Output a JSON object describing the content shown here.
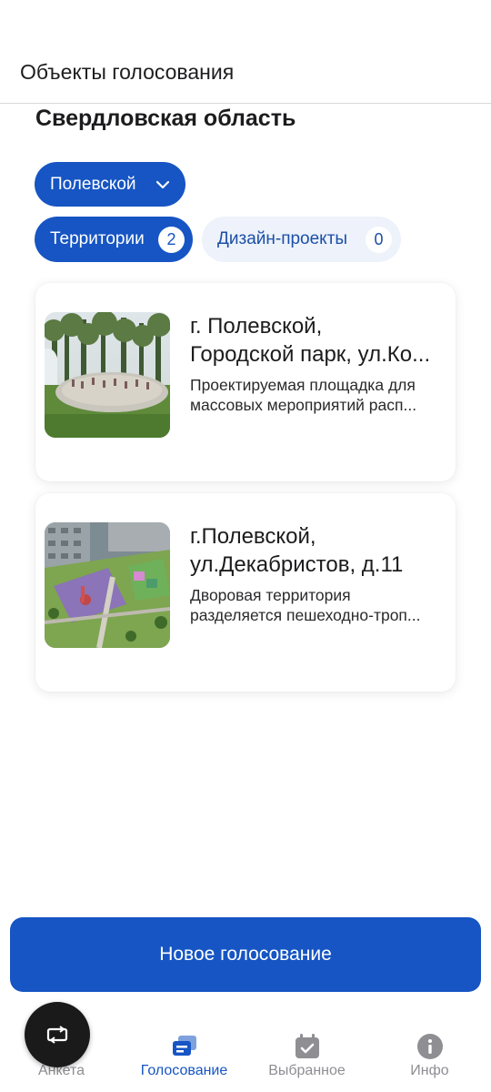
{
  "header": {
    "title": "Объекты голосования"
  },
  "region": {
    "title": "Свердловская область"
  },
  "city_select": {
    "value": "Полевской",
    "icon": "chevron-down-icon"
  },
  "tabs": [
    {
      "label": "Территории",
      "count": "2",
      "active": true
    },
    {
      "label": "Дизайн-проекты",
      "count": "0",
      "active": false
    }
  ],
  "cards": [
    {
      "title_line1": "г. Полевской,",
      "title_line2": "Городской парк, ул.Ко...",
      "desc_line1": "Проектируемая площадка для",
      "desc_line2": "массовых мероприятий расп..."
    },
    {
      "title_line1": "г.Полевской,",
      "title_line2": "ул.Декабристов, д.11",
      "desc_line1": "Дворовая территория",
      "desc_line2": "разделяется пешеходно-троп..."
    }
  ],
  "actions": {
    "new_vote": "Новое голосование"
  },
  "nav": {
    "items": [
      {
        "label": "Анкета",
        "icon": "survey-icon"
      },
      {
        "label": "Голосование",
        "icon": "vote-icon",
        "active": true
      },
      {
        "label": "Выбранное",
        "icon": "calendar-check-icon"
      },
      {
        "label": "Инфо",
        "icon": "info-icon"
      }
    ]
  },
  "colors": {
    "primary": "#1655c3",
    "tab_inactive_bg": "#edf2fb",
    "muted": "#8e8e93"
  }
}
